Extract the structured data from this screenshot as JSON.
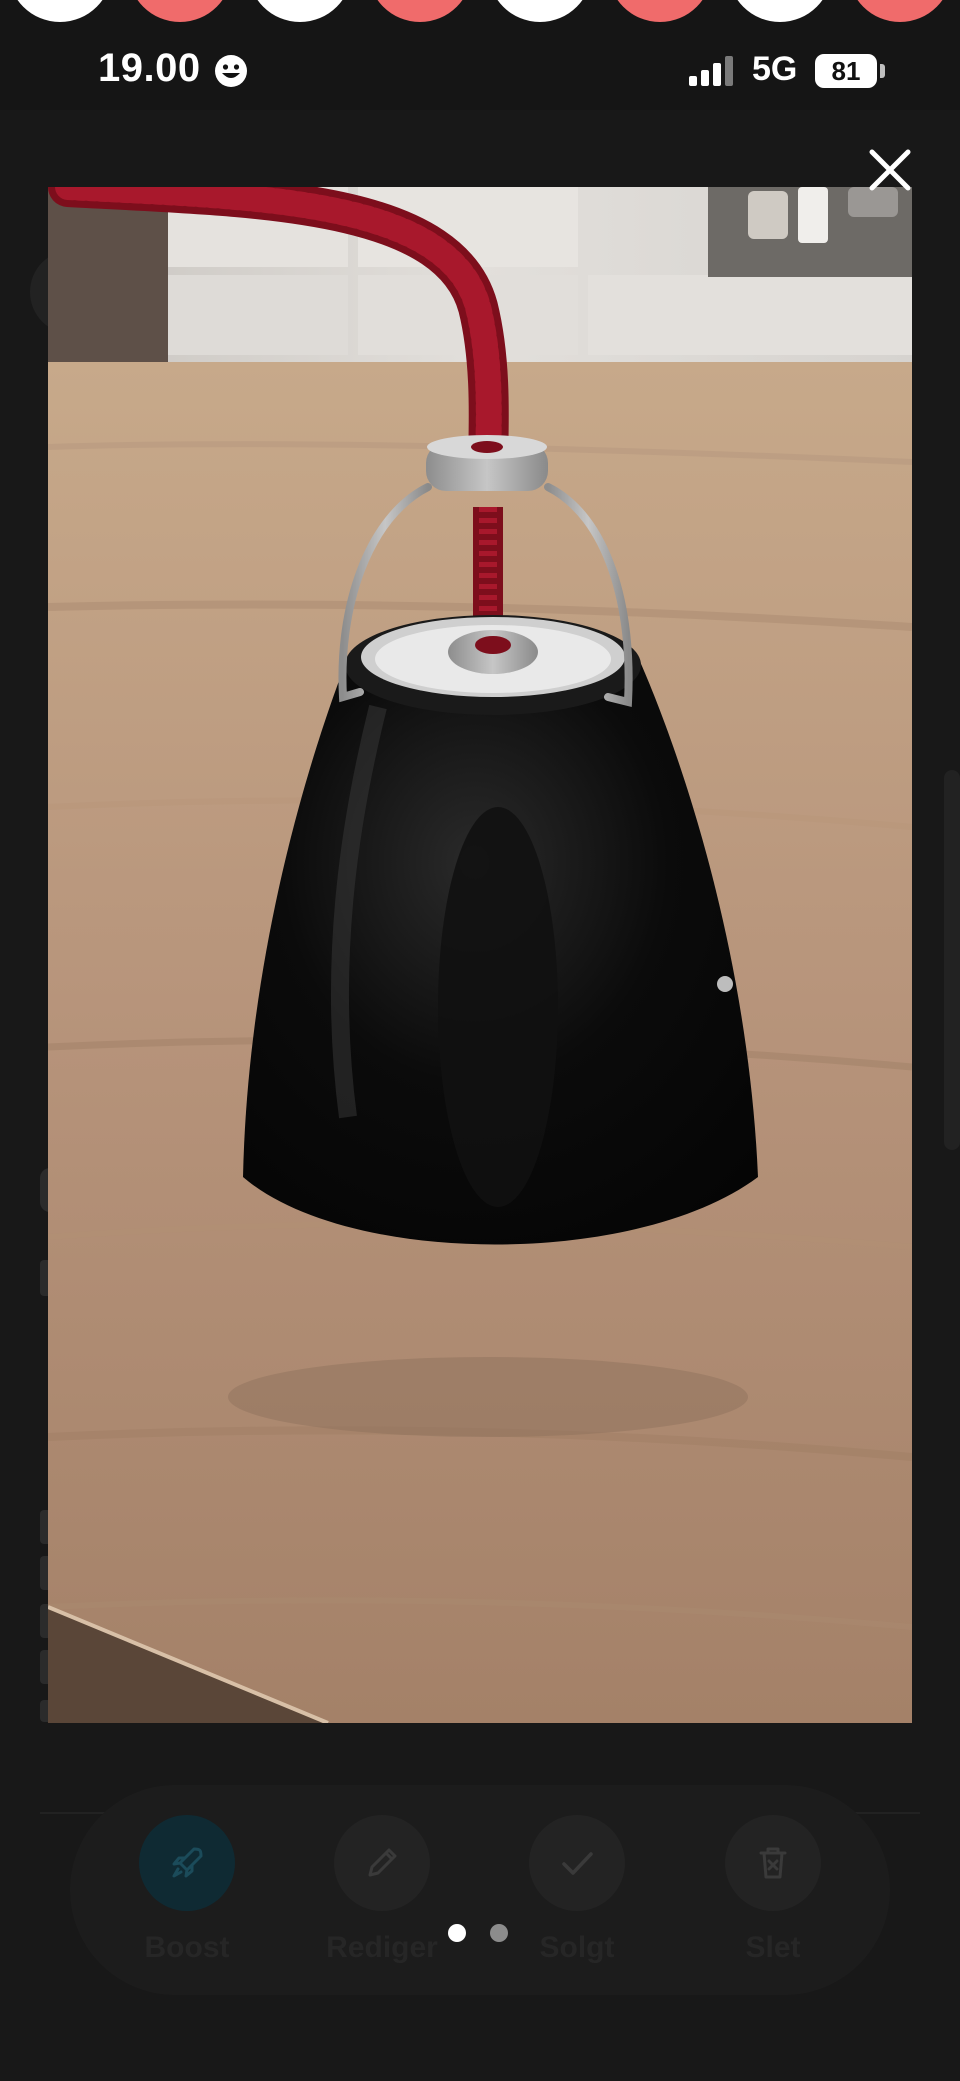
{
  "status_bar": {
    "time": "19.00",
    "network": "5G",
    "battery": "81",
    "icons": [
      "smiley-icon",
      "signal-icon"
    ]
  },
  "background_page": {
    "actions": [
      {
        "label": "Boost",
        "icon": "rocket-icon"
      },
      {
        "label": "Rediger",
        "icon": "pencil-icon"
      },
      {
        "label": "Solgt",
        "icon": "checkmark-icon"
      },
      {
        "label": "Slet",
        "icon": "trash-icon"
      }
    ],
    "colors": {
      "boost_tint": "#0f2a33",
      "action_bg": "#232323"
    }
  },
  "viewer": {
    "close_icon": "close-icon",
    "page_count": 2,
    "current_page": 1
  },
  "colors": {
    "background": "#151515",
    "deco_coral": "#f06b6b",
    "deco_white": "#ffffff",
    "cord_red": "#8c1020"
  }
}
